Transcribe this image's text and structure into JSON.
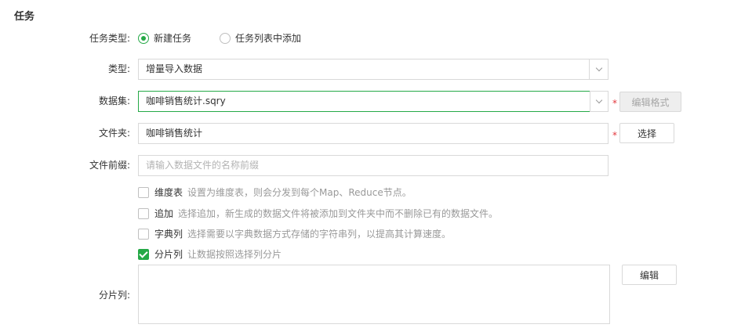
{
  "section": {
    "title": "任务"
  },
  "task_type": {
    "label": "任务类型:",
    "options": [
      {
        "label": "新建任务",
        "checked": true
      },
      {
        "label": "任务列表中添加",
        "checked": false
      }
    ]
  },
  "type": {
    "label": "类型:",
    "value": "增量导入数据"
  },
  "dataset": {
    "label": "数据集:",
    "value": "咖啡销售统计.sqry",
    "required": "*",
    "edit_format_label": "编辑格式"
  },
  "folder": {
    "label": "文件夹:",
    "value": "咖啡销售统计",
    "required": "*",
    "select_label": "选择"
  },
  "prefix": {
    "label": "文件前缀:",
    "placeholder": "请输入数据文件的名称前缀"
  },
  "options": [
    {
      "label": "维度表",
      "desc": "设置为维度表，则会分发到每个Map、Reduce节点。",
      "checked": false
    },
    {
      "label": "追加",
      "desc": "选择追加，新生成的数据文件将被添加到文件夹中而不删除已有的数据文件。",
      "checked": false
    },
    {
      "label": "字典列",
      "desc": "选择需要以字典数据方式存储的字符串列，以提高其计算速度。",
      "checked": false
    },
    {
      "label": "分片列",
      "desc": "让数据按照选择列分片",
      "checked": true
    }
  ],
  "partition": {
    "label": "分片列:",
    "edit_label": "编辑"
  },
  "colors": {
    "accent": "#25a947",
    "required": "#e2373d"
  },
  "icons": {
    "dropdown": "chevron-down-icon",
    "check": "check-icon"
  }
}
